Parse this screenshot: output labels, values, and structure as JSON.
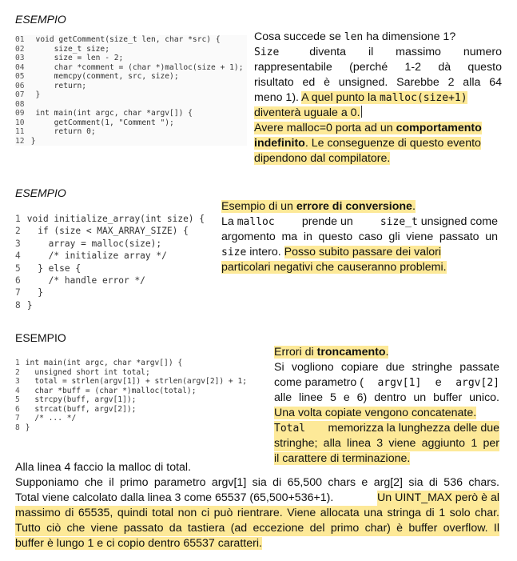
{
  "section1": {
    "title": "ESEMPIO",
    "code": [
      {
        "n": "01",
        "t": "  void getComment(size_t len, char *src) {"
      },
      {
        "n": "02",
        "t": "      size_t size;"
      },
      {
        "n": "03",
        "t": "      size = len - 2;"
      },
      {
        "n": "04",
        "t": "      char *comment = (char *)malloc(size + 1);"
      },
      {
        "n": "05",
        "t": "      memcpy(comment, src, size);"
      },
      {
        "n": "06",
        "t": "      return;"
      },
      {
        "n": "07",
        "t": "  }"
      },
      {
        "n": "08",
        "t": ""
      },
      {
        "n": "09",
        "t": "  int main(int argc, char *argv[]) {"
      },
      {
        "n": "10",
        "t": "      getComment(1, \"Comment \");"
      },
      {
        "n": "11",
        "t": "      return 0;"
      },
      {
        "n": "12",
        "t": " }"
      }
    ],
    "note": {
      "l1a": "Cosa succede se ",
      "l1code": "len",
      "l1b": " ha dimensione 1?",
      "l2code": "Size",
      "l2a": " diventa il massimo numero",
      "l3": "rappresentabile (perché 1-2 dà questo",
      "l4": "risultato ed è unsigned. Sarebbe 2 alla 64",
      "l5a": "meno 1). ",
      "l5b": "A quel punto la ",
      "l5code": "malloc(size+1)",
      "l6": "diventerà uguale a 0.",
      "l7a": "Avere malloc=0 porta ad un ",
      "l7b": "comportamento",
      "l8a": "indefinito",
      "l8b": ". Le conseguenze di questo evento",
      "l9": "dipendono dal compilatore."
    }
  },
  "section2": {
    "title": "ESEMPIO",
    "code": [
      {
        "n": "1",
        "t": " void initialize_array(int size) {"
      },
      {
        "n": "2",
        "t": "   if (size < MAX_ARRAY_SIZE) {"
      },
      {
        "n": "3",
        "t": "     array = malloc(size);"
      },
      {
        "n": "4",
        "t": "     /* initialize array */"
      },
      {
        "n": "5",
        "t": "   } else {"
      },
      {
        "n": "6",
        "t": "     /* handle error */"
      },
      {
        "n": "7",
        "t": "   }"
      },
      {
        "n": "8",
        "t": " }"
      }
    ],
    "note": {
      "l1a": "Esempio di un ",
      "l1b": "errore di conversione",
      "l1c": ".",
      "l2a": "La ",
      "l2code1": "malloc",
      "l2b": " prende un ",
      "l2code2": "size_t",
      "l2c": " unsigned come",
      "l3": "argomento ma in questo caso gli viene passato un",
      "l4code": "size",
      "l4a": " intero. ",
      "l4b": "Posso subito passare dei valori",
      "l5": "particolari negativi che causeranno problemi."
    }
  },
  "section3": {
    "title": "ESEMPIO",
    "code": [
      {
        "n": "1",
        "t": " int main(int argc, char *argv[]) {"
      },
      {
        "n": "2",
        "t": "   unsigned short int total;"
      },
      {
        "n": "3",
        "t": "   total = strlen(argv[1]) + strlen(argv[2]) + 1;"
      },
      {
        "n": "4",
        "t": "   char *buff = (char *)malloc(total);"
      },
      {
        "n": "5",
        "t": "   strcpy(buff, argv[1]);"
      },
      {
        "n": "6",
        "t": "   strcat(buff, argv[2]);"
      },
      {
        "n": "7",
        "t": "   /* ... */"
      },
      {
        "n": "8",
        "t": " }"
      }
    ],
    "note": {
      "l1a": "Errori di ",
      "l1b": "troncamento",
      "l1c": ".",
      "l2": "Si vogliono copiare due stringhe passate",
      "l3a": "come parametro (",
      "l3code1": "argv[1]",
      "l3b": " e ",
      "l3code2": "argv[2]",
      "l4": "alle linee 5 e 6) dentro un buffer unico.",
      "l5": "Una volta copiate vengono concatenate.",
      "l6code": "Total",
      "l6a": " memorizza la lunghezza delle due",
      "l7": "stringhe; alla linea 3 viene aggiunto 1 per",
      "l8": "il carattere di terminazione."
    }
  },
  "bottom": {
    "l1": "Alla linea 4 faccio la malloc di total.",
    "l2": "Supponiamo che il primo parametro argv[1] sia di  65,500 chars e arg[2] sia di 536 chars.",
    "l3a": "Total viene calcolato dalla linea 3 come 65537 (65,500+536+1). ",
    "l3b": "Un UINT_MAX però è al",
    "l4": "massimo di 65535, quindi total non ci può rientrare. Viene allocata una stringa di 1 solo char.",
    "l5": "Tutto ciò che viene passato da tastiera (ad eccezione del primo char) è buffer overflow. Il",
    "l6": "buffer è lungo 1 e ci copio dentro 65537 caratteri."
  }
}
